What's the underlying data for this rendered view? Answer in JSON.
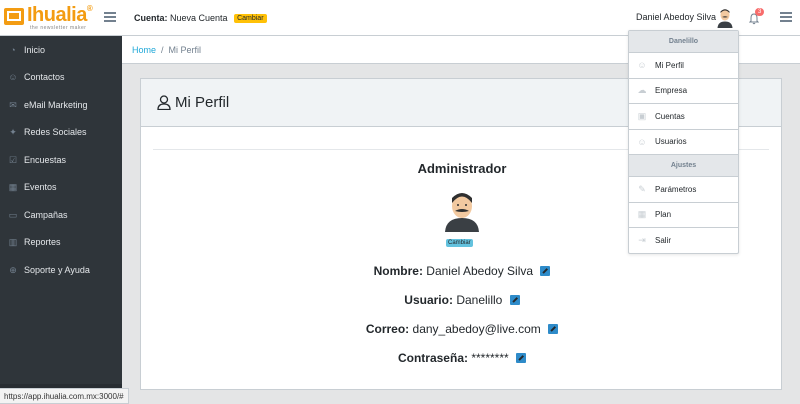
{
  "brand": {
    "name": "Ihualia",
    "reg": "®",
    "tagline": "the newsletter maker"
  },
  "header": {
    "account_label": "Cuenta:",
    "account_name": "Nueva Cuenta",
    "change_label": "Cambiar",
    "user_name": "Daniel Abedoy Silva",
    "notification_count": "3"
  },
  "sidebar": {
    "items": [
      {
        "label": "Inicio",
        "icon": "speedometer-icon"
      },
      {
        "label": "Contactos",
        "icon": "people-icon"
      },
      {
        "label": "eMail Marketing",
        "icon": "envelope-icon"
      },
      {
        "label": "Redes Sociales",
        "icon": "twitter-icon"
      },
      {
        "label": "Encuestas",
        "icon": "check-square-icon"
      },
      {
        "label": "Eventos",
        "icon": "calendar-icon"
      },
      {
        "label": "Campañas",
        "icon": "map-icon"
      },
      {
        "label": "Reportes",
        "icon": "chart-icon"
      },
      {
        "label": "Soporte y Ayuda",
        "icon": "globe-icon"
      }
    ]
  },
  "breadcrumb": {
    "home": "Home",
    "separator": "/",
    "current": "Mi Perfil"
  },
  "profile": {
    "title": "Mi Perfil",
    "role": "Administrador",
    "change_label": "Cambiar",
    "name_label": "Nombre:",
    "name_value": "Daniel Abedoy Silva",
    "user_label": "Usuario:",
    "user_value": "Danelillo",
    "email_label": "Correo:",
    "email_value": "dany_abedoy@live.com",
    "password_label": "Contraseña:",
    "password_value": "********"
  },
  "dropdown": {
    "header1": "Danelillo",
    "items1": [
      {
        "label": "Mi Perfil",
        "icon": "user-icon"
      },
      {
        "label": "Empresa",
        "icon": "cloud-icon"
      },
      {
        "label": "Cuentas",
        "icon": "briefcase-icon"
      },
      {
        "label": "Usuarios",
        "icon": "users-icon"
      }
    ],
    "header2": "Ajustes",
    "items2": [
      {
        "label": "Parámetros",
        "icon": "wrench-icon"
      },
      {
        "label": "Plan",
        "icon": "layout-icon"
      },
      {
        "label": "Salir",
        "icon": "logout-icon"
      }
    ]
  },
  "status_url": "https://app.ihualia.com.mx:3000/#",
  "colors": {
    "brand": "#f39c12",
    "sidebar": "#2f353a",
    "link": "#20a8d8",
    "badge": "#ffc107"
  }
}
